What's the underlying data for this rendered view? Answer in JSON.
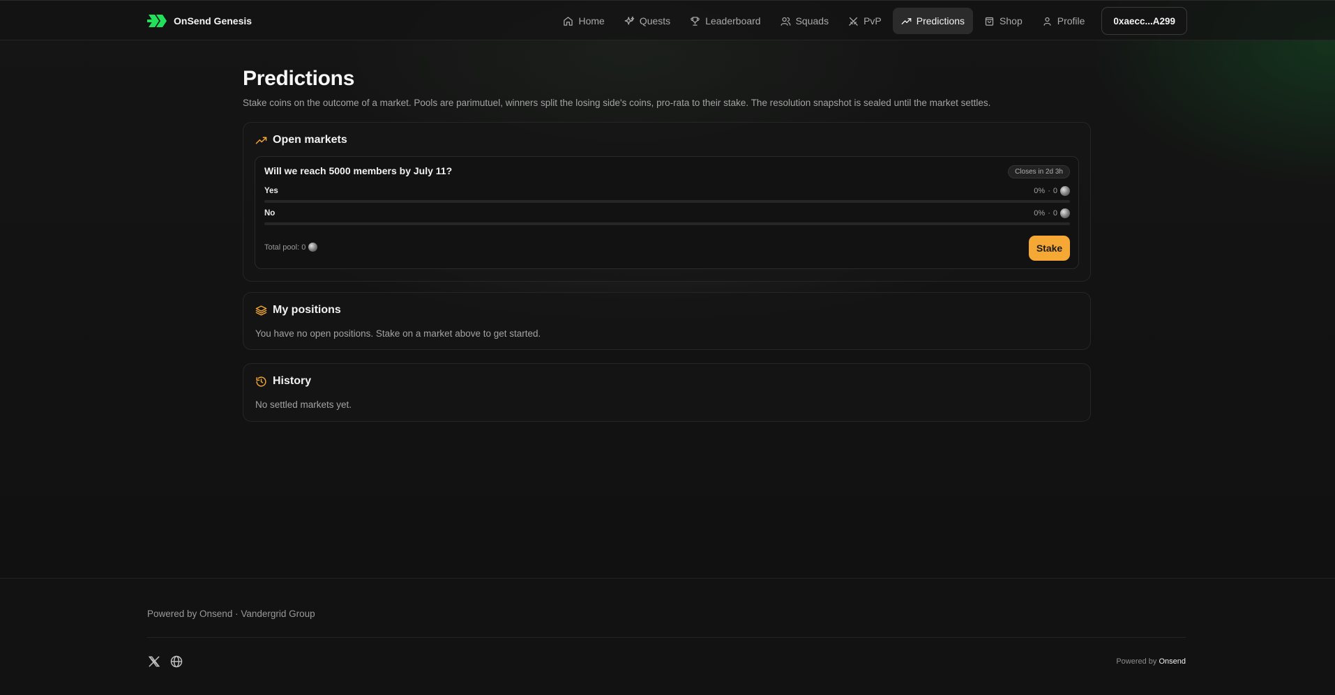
{
  "colors": {
    "accent": "#f5a834",
    "brand_green": "#22e05a",
    "background": "#121212"
  },
  "brand": {
    "name": "OnSend Genesis",
    "logo_icon": "double-arrow-logo"
  },
  "nav": {
    "items": [
      {
        "label": "Home",
        "icon": "home-icon"
      },
      {
        "label": "Quests",
        "icon": "sparkle-icon"
      },
      {
        "label": "Leaderboard",
        "icon": "trophy-icon"
      },
      {
        "label": "Squads",
        "icon": "users-icon"
      },
      {
        "label": "PvP",
        "icon": "crossed-swords-icon"
      },
      {
        "label": "Predictions",
        "icon": "trending-up-icon",
        "active": true
      },
      {
        "label": "Shop",
        "icon": "shopping-bag-icon"
      },
      {
        "label": "Profile",
        "icon": "user-icon"
      }
    ],
    "wallet": "0xaecc...A299"
  },
  "page": {
    "title": "Predictions",
    "subtitle": "Stake coins on the outcome of a market. Pools are parimutuel, winners split the losing side's coins, pro-rata to their stake. The resolution snapshot is sealed until the market settles."
  },
  "open_markets": {
    "title": "Open markets",
    "icon": "trending-up-icon",
    "markets": [
      {
        "question": "Will we reach 5000 members by July 11?",
        "closes": "Closes in 2d 3h",
        "outcomes": [
          {
            "label": "Yes",
            "percent": "0%",
            "separator": "·",
            "amount": "0",
            "share": 0
          },
          {
            "label": "No",
            "percent": "0%",
            "separator": "·",
            "amount": "0",
            "share": 0
          }
        ],
        "total_pool_label": "Total pool: 0",
        "stake_label": "Stake"
      }
    ]
  },
  "positions": {
    "title": "My positions",
    "icon": "layers-icon",
    "empty_text": "You have no open positions. Stake on a market above to get started."
  },
  "history": {
    "title": "History",
    "icon": "history-icon",
    "empty_text": "No settled markets yet."
  },
  "footer": {
    "credit": "Powered by Onsend · Vandergrid Group",
    "socials": [
      "x-icon",
      "globe-icon"
    ],
    "powered_prefix": "Powered by",
    "powered_brand": "Onsend"
  }
}
